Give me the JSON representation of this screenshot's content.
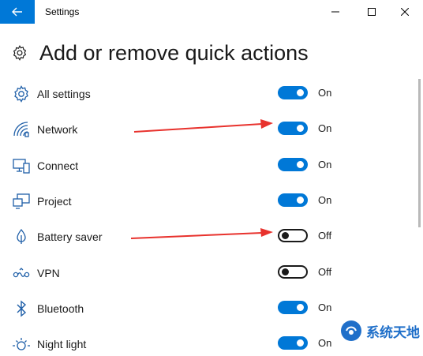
{
  "window": {
    "title": "Settings",
    "back_icon": "back-arrow-icon",
    "controls": [
      "minimize-icon",
      "maximize-icon",
      "close-icon"
    ]
  },
  "page": {
    "title": "Add or remove quick actions",
    "title_icon": "gear-icon"
  },
  "rows": [
    {
      "label": "All settings",
      "icon": "gear-icon",
      "state": "On"
    },
    {
      "label": "Network",
      "icon": "network-icon",
      "state": "On"
    },
    {
      "label": "Connect",
      "icon": "connect-icon",
      "state": "On"
    },
    {
      "label": "Project",
      "icon": "project-icon",
      "state": "On"
    },
    {
      "label": "Battery saver",
      "icon": "battery-saver-icon",
      "state": "Off"
    },
    {
      "label": "VPN",
      "icon": "vpn-icon",
      "state": "Off"
    },
    {
      "label": "Bluetooth",
      "icon": "bluetooth-icon",
      "state": "On"
    },
    {
      "label": "Night light",
      "icon": "night-light-icon",
      "state": "On"
    }
  ],
  "colors": {
    "accent": "#0078d7",
    "annotation_arrow": "#e8322d",
    "watermark": "#1f6fc9"
  },
  "watermark": {
    "text": "系统天地"
  }
}
